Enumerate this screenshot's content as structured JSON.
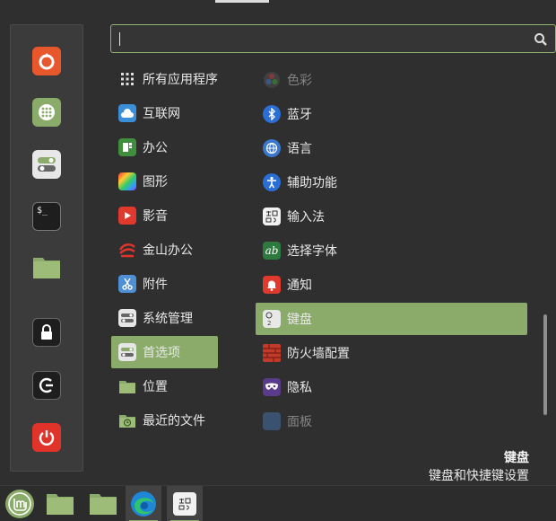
{
  "search": {
    "value": "",
    "placeholder": ""
  },
  "favorites": [
    {
      "name": "firefox-icon",
      "color": "#e8562b"
    },
    {
      "name": "software-manager-icon",
      "color": "#8aab6a"
    },
    {
      "name": "system-settings-icon",
      "color": "#e8e8e8"
    },
    {
      "name": "terminal-icon",
      "color": "#222222"
    },
    {
      "name": "files-icon",
      "color": "#8aab6a"
    },
    {
      "name": "lock-screen-icon",
      "color": "#222222"
    },
    {
      "name": "logout-icon",
      "color": "#222222"
    },
    {
      "name": "shutdown-icon",
      "color": "#e0342a"
    }
  ],
  "categories": [
    {
      "label": "所有应用程序",
      "icon": "grid-icon"
    },
    {
      "label": "互联网",
      "icon": "cloud-icon"
    },
    {
      "label": "办公",
      "icon": "office-icon"
    },
    {
      "label": "图形",
      "icon": "graphics-icon"
    },
    {
      "label": "影音",
      "icon": "play-icon"
    },
    {
      "label": "金山办公",
      "icon": "wps-icon"
    },
    {
      "label": "附件",
      "icon": "scissors-icon"
    },
    {
      "label": "系统管理",
      "icon": "admin-icon"
    },
    {
      "label": "首选项",
      "icon": "preferences-icon",
      "selected": true
    },
    {
      "label": "位置",
      "icon": "folder-icon"
    },
    {
      "label": "最近的文件",
      "icon": "recent-folder-icon"
    }
  ],
  "apps": [
    {
      "label": "色彩",
      "icon": "color-icon",
      "dim": true
    },
    {
      "label": "蓝牙",
      "icon": "bluetooth-icon"
    },
    {
      "label": "语言",
      "icon": "language-icon"
    },
    {
      "label": "辅助功能",
      "icon": "accessibility-icon"
    },
    {
      "label": "输入法",
      "icon": "input-method-icon"
    },
    {
      "label": "选择字体",
      "icon": "font-icon"
    },
    {
      "label": "通知",
      "icon": "bell-icon"
    },
    {
      "label": "键盘",
      "icon": "keyboard-icon",
      "selected": true
    },
    {
      "label": "防火墙配置",
      "icon": "firewall-icon"
    },
    {
      "label": "隐私",
      "icon": "privacy-mask-icon"
    },
    {
      "label": "面板",
      "icon": "panel-icon",
      "dim": true
    }
  ],
  "description": {
    "title": "键盘",
    "text": "键盘和快捷键设置"
  },
  "accent": "#8aab6a"
}
